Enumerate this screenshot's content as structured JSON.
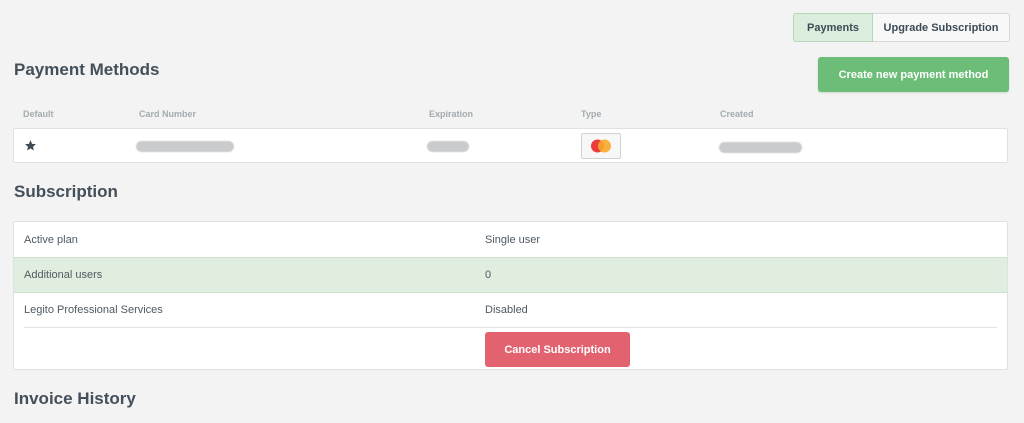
{
  "tabs": {
    "payments": "Payments",
    "upgrade": "Upgrade Subscription"
  },
  "payment_methods": {
    "title": "Payment Methods",
    "create_button": "Create new payment method",
    "columns": [
      "Default",
      "Card Number",
      "Expiration",
      "Type",
      "Created"
    ],
    "card": {
      "default_icon": "star-icon",
      "type_icon": "mastercard-icon"
    }
  },
  "subscription": {
    "title": "Subscription",
    "rows": [
      {
        "key": "Active plan",
        "value": "Single user"
      },
      {
        "key": "Additional users",
        "value": "0"
      },
      {
        "key": "Legito Professional Services",
        "value": "Disabled"
      }
    ],
    "cancel_button": "Cancel Subscription"
  },
  "invoice_history": {
    "title": "Invoice History"
  },
  "colors": {
    "accent_green": "#6cbd77",
    "danger": "#e2636f",
    "highlight": "#dfeedf"
  }
}
